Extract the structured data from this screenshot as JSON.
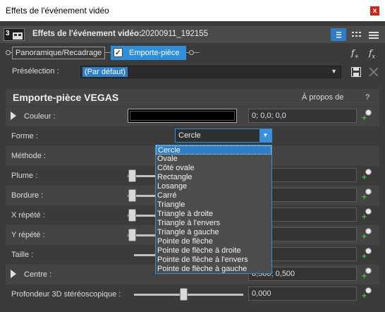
{
  "window": {
    "title": "Effets de l'événement vidéo",
    "close_glyph": "x"
  },
  "header": {
    "icon_text": "3",
    "label": "Effets de l'événement vidéo:",
    "event_name": "20200911_192155"
  },
  "chain": {
    "item1": "Panoramique/Recadrage",
    "item2": "Emporte-pièce",
    "item2_checked": "✓"
  },
  "preset": {
    "label": "Présélection :",
    "value": "(Par défaut)"
  },
  "panel": {
    "title": "Emporte-pièce VEGAS",
    "about": "À propos de",
    "help": "?",
    "rows": {
      "couleur": {
        "label": "Couleur :",
        "value": "0; 0,0; 0,0"
      },
      "forme": {
        "label": "Forme :",
        "value": "Cercle"
      },
      "methode": {
        "label": "Méthode :"
      },
      "plume": {
        "label": "Plume :"
      },
      "bordure": {
        "label": "Bordure :"
      },
      "xrepete": {
        "label": "X répété :"
      },
      "yrepete": {
        "label": "Y répété :"
      },
      "taille": {
        "label": "Taille :"
      },
      "centre": {
        "label": "Centre :",
        "value": "0,500; 0,500"
      },
      "profondeur": {
        "label": "Profondeur 3D stéréoscopique :",
        "value": "0,000"
      }
    }
  },
  "dropdown": {
    "options": [
      "Cercle",
      "Ovale",
      "Côté ovale",
      "Rectangle",
      "Losange",
      "Carré",
      "Triangle",
      "Triangle à droite",
      "Triangle à l'envers",
      "Triangle à gauche",
      "Pointe de flèche",
      "Pointe de flèche à droite",
      "Pointe de flèche à l'envers",
      "Pointe de flèche à gauche"
    ],
    "selected": "Cercle"
  },
  "colors": {
    "accent": "#2f7fc8",
    "bg": "#3b3b3b",
    "close": "#c42b1c"
  }
}
